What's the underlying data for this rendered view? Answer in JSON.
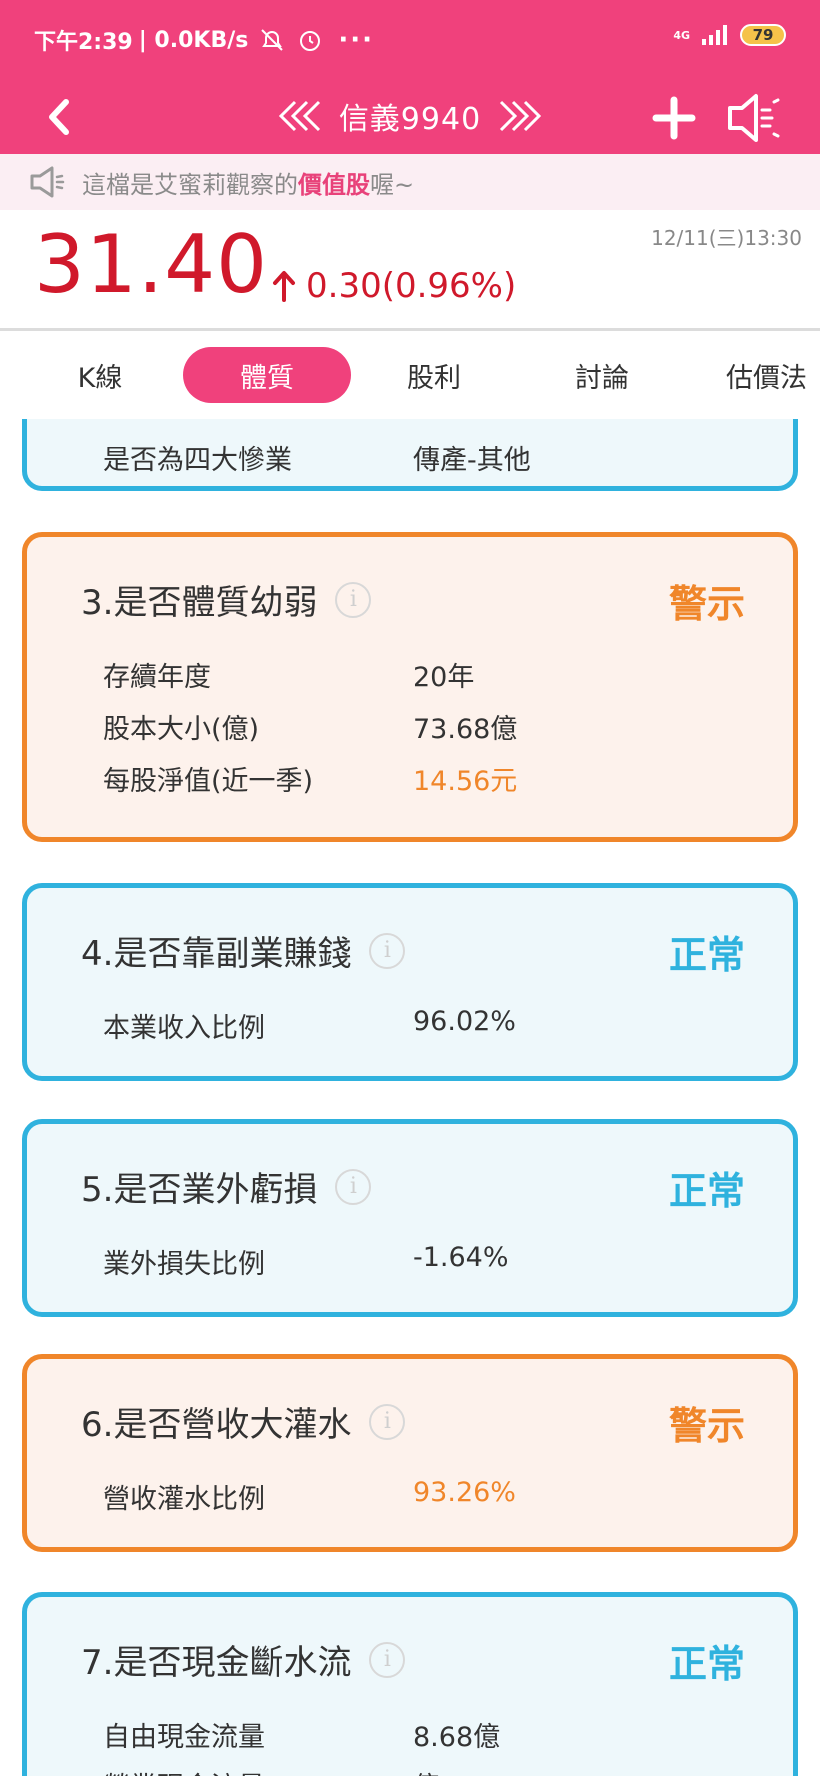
{
  "status_bar": {
    "time": "下午2:39",
    "net_speed": "| 0.0KB/s",
    "more": "···",
    "network": "4G",
    "battery": "79"
  },
  "nav": {
    "title": "信義9940",
    "prev_label": "《《",
    "next_label": "》》"
  },
  "notice": {
    "prefix": "這檔是艾蜜莉觀察的",
    "highlight": "價值股",
    "suffix": "喔~"
  },
  "quote": {
    "price": "31.40",
    "change": "0.30(0.96%)",
    "date": "12/11(三)13:30",
    "up_color": "#d0192b"
  },
  "tabs": [
    {
      "label": "K線"
    },
    {
      "label": "體質"
    },
    {
      "label": "股利"
    },
    {
      "label": "討論"
    },
    {
      "label": "估價法"
    }
  ],
  "active_tab": "體質",
  "cards": {
    "card2_partial": {
      "rows": [
        {
          "k": "是否為四大慘業",
          "v": "傳產-其他"
        }
      ]
    },
    "card3": {
      "title": "3.是否體質幼弱",
      "status": "警示",
      "rows": [
        {
          "k": "存續年度",
          "v": "20年"
        },
        {
          "k": "股本大小(億)",
          "v": "73.68億"
        },
        {
          "k": "每股淨值(近一季)",
          "v": "14.56元"
        }
      ]
    },
    "card4": {
      "title": "4.是否靠副業賺錢",
      "status": "正常",
      "rows": [
        {
          "k": "本業收入比例",
          "v": "96.02%"
        }
      ]
    },
    "card5": {
      "title": "5.是否業外虧損",
      "status": "正常",
      "rows": [
        {
          "k": "業外損失比例",
          "v": "-1.64%"
        }
      ]
    },
    "card6": {
      "title": "6.是否營收大灌水",
      "status": "警示",
      "rows": [
        {
          "k": "營收灌水比例",
          "v": "93.26%"
        }
      ]
    },
    "card7": {
      "title": "7.是否現金斷水流",
      "status": "正常",
      "rows": [
        {
          "k": "自由現金流量",
          "v": "8.68億"
        },
        {
          "k": "營業現金流量",
          "v": "億"
        }
      ]
    }
  },
  "info_glyph": "i",
  "colors": {
    "brand_pink": "#f0417c",
    "normal_blue": "#2fb2de",
    "warning_orange": "#f0862a"
  }
}
